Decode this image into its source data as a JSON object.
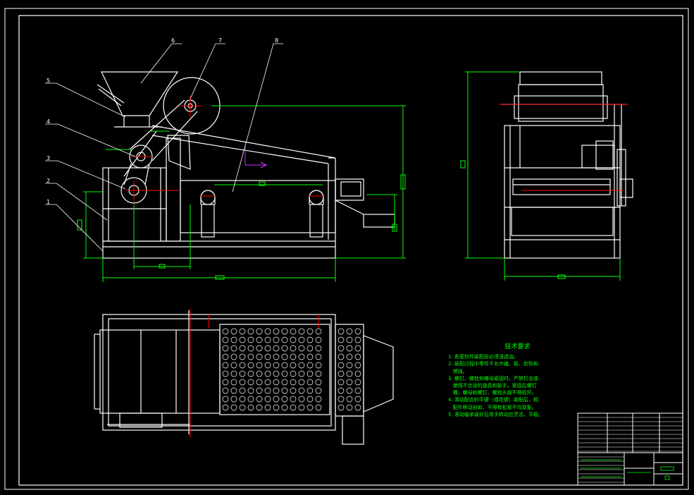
{
  "balloons": [
    {
      "label": "1"
    },
    {
      "label": "2"
    },
    {
      "label": "3"
    },
    {
      "label": "4"
    },
    {
      "label": "5"
    },
    {
      "label": "6"
    },
    {
      "label": "7"
    },
    {
      "label": "8"
    }
  ],
  "notes": {
    "title": "技术要求",
    "lines": [
      "1. 各密封件装配前必须浸透油。",
      "2. 装配过程中零件不允许磕、碰、划伤和",
      "   锈蚀。",
      "3. 螺钉、螺栓和螺母紧固时，严禁打击或",
      "   使用不合适的旋具和扳手。紧固后螺钉",
      "   槽、螺母和螺钉、螺栓头部不得损坏。",
      "4. 滑动配合的平键（或花键）装配后，相",
      "   配件移动自如，不得有松紧不均现象。",
      "5. 滚动轴承装好后用手转动应灵活、平稳。"
    ]
  },
  "colors": {
    "background": "#000000",
    "outline": "#ffffff",
    "dimension": "#00ff00",
    "center": "#ff0000",
    "arrow": "#cc33ff"
  }
}
